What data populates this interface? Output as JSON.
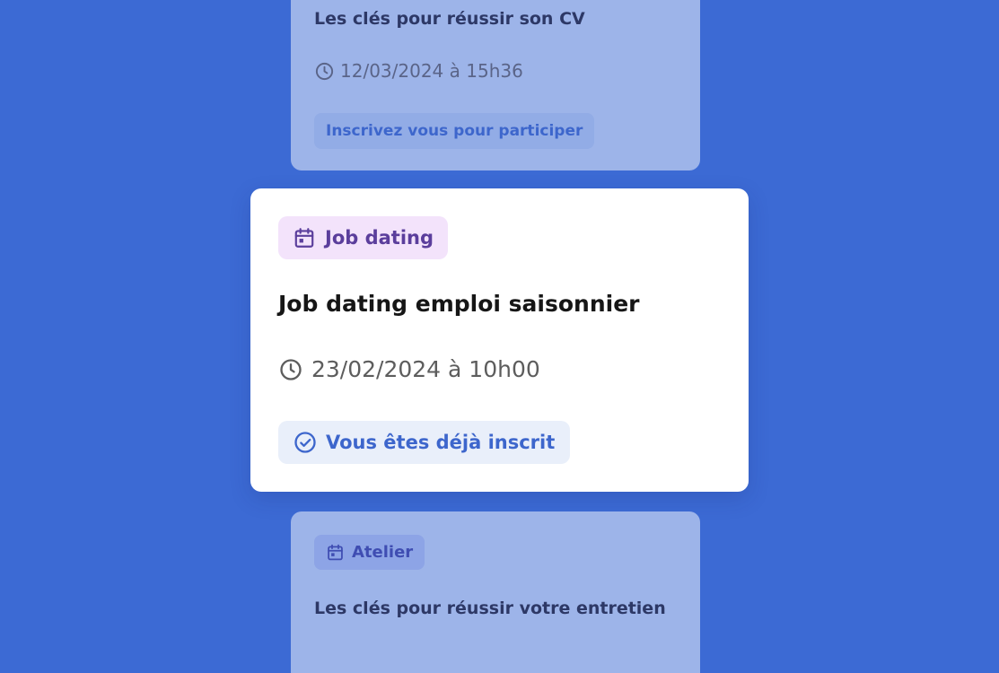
{
  "top_card": {
    "title": "Les clés pour réussir son CV",
    "date": "12/03/2024 à 15h36",
    "date_icon": "clock-icon",
    "action_label": "Inscrivez vous pour participer"
  },
  "main_card": {
    "badge_label": "Job dating",
    "badge_icon": "calendar-icon",
    "title": "Job dating emploi saisonnier",
    "date": "23/02/2024 à 10h00",
    "date_icon": "clock-icon",
    "status_label": "Vous êtes déjà inscrit",
    "status_icon": "check-circle-icon"
  },
  "bottom_card": {
    "badge_label": "Atelier",
    "badge_icon": "calendar-icon",
    "title": "Les clés pour réussir votre entretien"
  },
  "colors": {
    "background": "#3c6ad4",
    "faded_card": "#9db4e9",
    "main_card": "#ffffff",
    "accent_blue": "#3d66cc",
    "badge_purple_bg": "#f3e3fb",
    "badge_purple_text": "#5b3e9c"
  }
}
